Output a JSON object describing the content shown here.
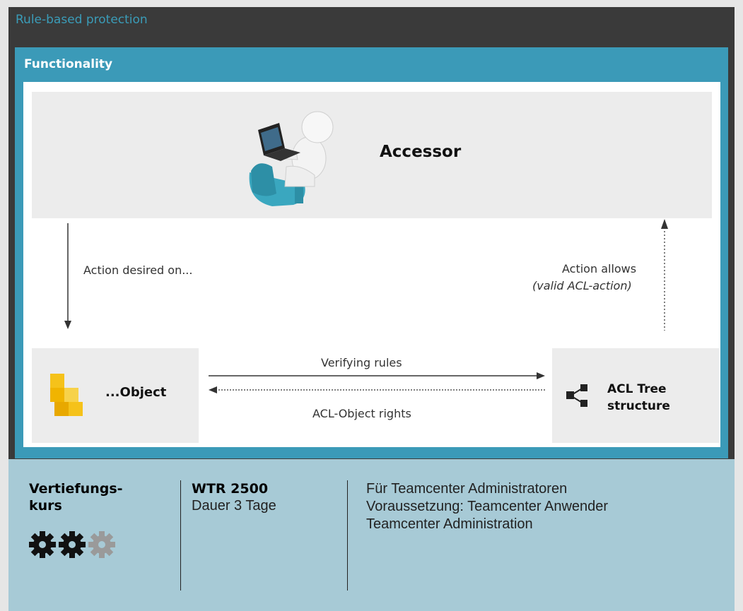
{
  "slide": {
    "title": "Rule-based protection",
    "panel_title": "Functionality"
  },
  "diagram": {
    "accessor_label": "Accessor",
    "action_desired": "Action desired on...",
    "action_allows": "Action allows",
    "action_allows_note": "(valid ACL-action)",
    "object_label": "...Object",
    "verifying_rules": "Verifying rules",
    "acl_object_rights": "ACL-Object rights",
    "acl_line1": "ACL Tree",
    "acl_line2": "structure"
  },
  "footer": {
    "level_line1": "Vertiefungs-",
    "level_line2": "kurs",
    "level_rating": 2,
    "level_max": 3,
    "course_code": "WTR 2500",
    "duration": "Dauer 3 Tage",
    "info1": "Für Teamcenter Administratoren",
    "info2": "Voraussetzung: Teamcenter Anwender",
    "info3": "Teamcenter Administration"
  },
  "colors": {
    "accent": "#3b9ab8",
    "dark": "#3a3a3a",
    "footer_bg": "#a7cad6",
    "gear_active": "#111111",
    "gear_inactive": "#9a9a9a"
  }
}
